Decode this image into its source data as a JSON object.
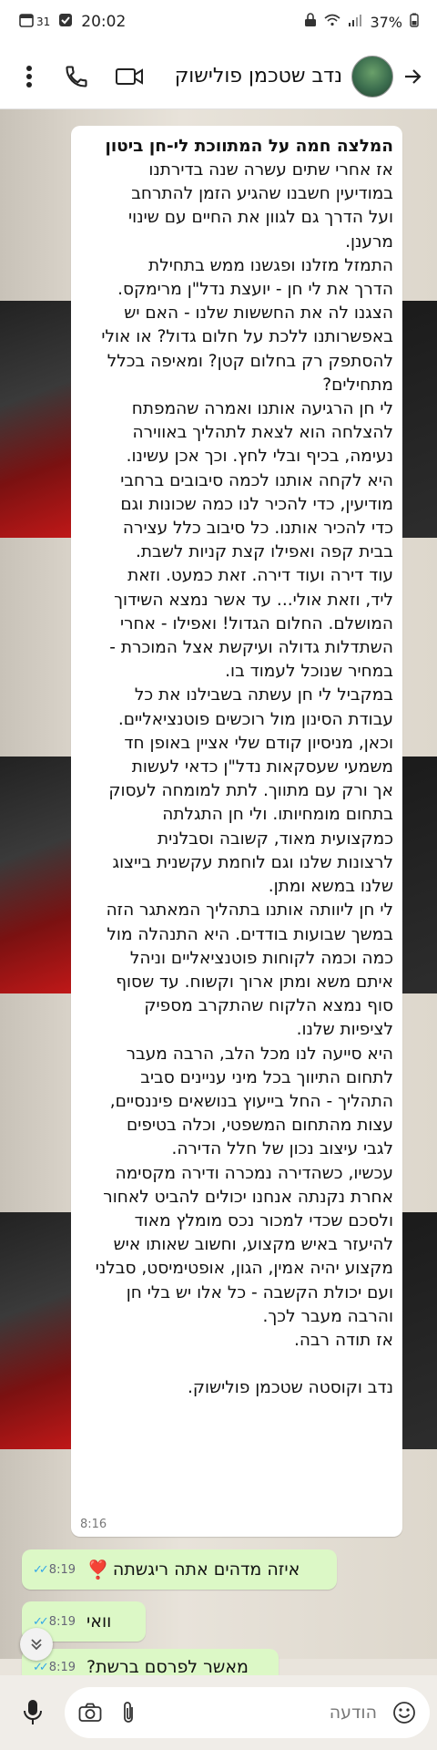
{
  "status_bar": {
    "battery": "37%",
    "time": "20:02",
    "calendar_day": "31"
  },
  "header": {
    "contact_name": "נדב שטכמן פולישוק"
  },
  "message_in": {
    "title": "המלצה חמה על המתווכת לי-חן ביטון",
    "lines": [
      "אז אחרי שתים עשרה שנה בדירתנו",
      "במודיעין חשבנו שהגיע הזמן להתרחב",
      "ועל הדרך גם לגוון את החיים עם שינוי",
      "מרענן.",
      "התמזל מזלנו ופגשנו ממש בתחילת",
      "הדרך את לי חן - יועצת נדל\"ן מרימקס.",
      "הצגנו לה את החששות שלנו - האם יש",
      "באפשרותנו ללכת על חלום גדול? או אולי",
      "להסתפק רק בחלום קטן? ומאיפה בכלל",
      "מתחילים?",
      "לי חן הרגיעה אותנו ואמרה שהמפתח",
      "להצלחה הוא לצאת לתהליך באווירה",
      "נעימה, בכיף ובלי לחץ. וכך אכן עשינו.",
      "היא לקחה אותנו לכמה סיבובים ברחבי",
      "מודיעין, כדי להכיר לנו כמה שכונות וגם",
      "כדי להכיר אותנו. כל סיבוב כלל עצירה",
      "בבית קפה ואפילו קצת קניות לשבת.",
      "עוד דירה ועוד דירה. זאת כמעט. וזאת",
      "ליד, וזאת אולי... עד אשר נמצא השידוך",
      "המושלם. החלום הגדול! ואפילו - אחרי",
      "השתדלות גדולה ועיקשת אצל המוכרת -",
      "במחיר שנוכל לעמוד בו.",
      "במקביל לי חן עשתה בשבילנו את כל",
      "עבודת הסינון מול רוכשים פוטנציאליים.",
      "וכאן, מניסיון קודם שלי אציין באופן  חד",
      "משמעי שעסקאות נדל\"ן כדאי לעשות",
      "אך ורק עם מתווך. לתת למומחה לעסוק",
      "בתחום מומחיותו. ולי חן התגלתה",
      "כמקצועית מאוד, קשובה וסבלנית",
      "לרצונות שלנו וגם לוחמת עקשנית בייצוג",
      "שלנו במשא ומתן.",
      "לי חן ליוותה אותנו בתהליך המאתגר הזה",
      "במשך שבועות בודדים. היא התנהלה מול",
      "כמה וכמה לקוחות פוטנציאליים וניהל",
      "איתם משא ומתן ארוך וקשוח. עד שסוף",
      "סוף נמצא הלקוח שהתקרב מספיק",
      "לציפיות שלנו.",
      "היא סייעה לנו מכל הלב, הרבה מעבר",
      "לתחום התיווך בכל מיני עניינים סביב",
      "התהליך - החל בייעוץ בנושאים פיננסיים,",
      "עצות מהתחום המשפטי, וכלה בטיפים",
      "לגבי עיצוב נכון של חלל הדירה.",
      "עכשיו, כשהדירה נמכרה ודירה מקסימה",
      "אחרת נקנתה אנחנו יכולים להביט לאחור",
      "ולסכם שכדי למכור נכס מומלץ מאוד",
      "להיעזר באיש מקצוע, וחשוב שאותו איש",
      "מקצוע יהיה אמין, הגון, אופטימיסט, סבלני",
      "ועם יכולת הקשבה - כל אלו יש בלי חן",
      "והרבה מעבר לכך.",
      "אז תודה רבה.",
      "",
      "נדב וקוסטה שטכמן פולישוק."
    ],
    "time": "8:16"
  },
  "messages_out": [
    {
      "text": "איזה מדהים אתה ריגשתה",
      "emoji": "❣️",
      "time": "8:19"
    },
    {
      "text": "וואי",
      "emoji": "",
      "time": "8:19"
    },
    {
      "text": "מאשר לפרסם ברשת?",
      "emoji": "",
      "time": "8:19"
    }
  ],
  "input": {
    "placeholder": "הודעה"
  },
  "colors": {
    "outgoing_bubble": "#dcf8c6",
    "read_ticks": "#34a8e8"
  },
  "icons": {
    "back": "arrow-left",
    "video": "video-camera",
    "call": "phone",
    "menu": "three-dots-vertical",
    "mic": "microphone",
    "camera": "camera",
    "attach": "paperclip",
    "emoji": "smiley",
    "scroll": "double-chevron-down"
  }
}
